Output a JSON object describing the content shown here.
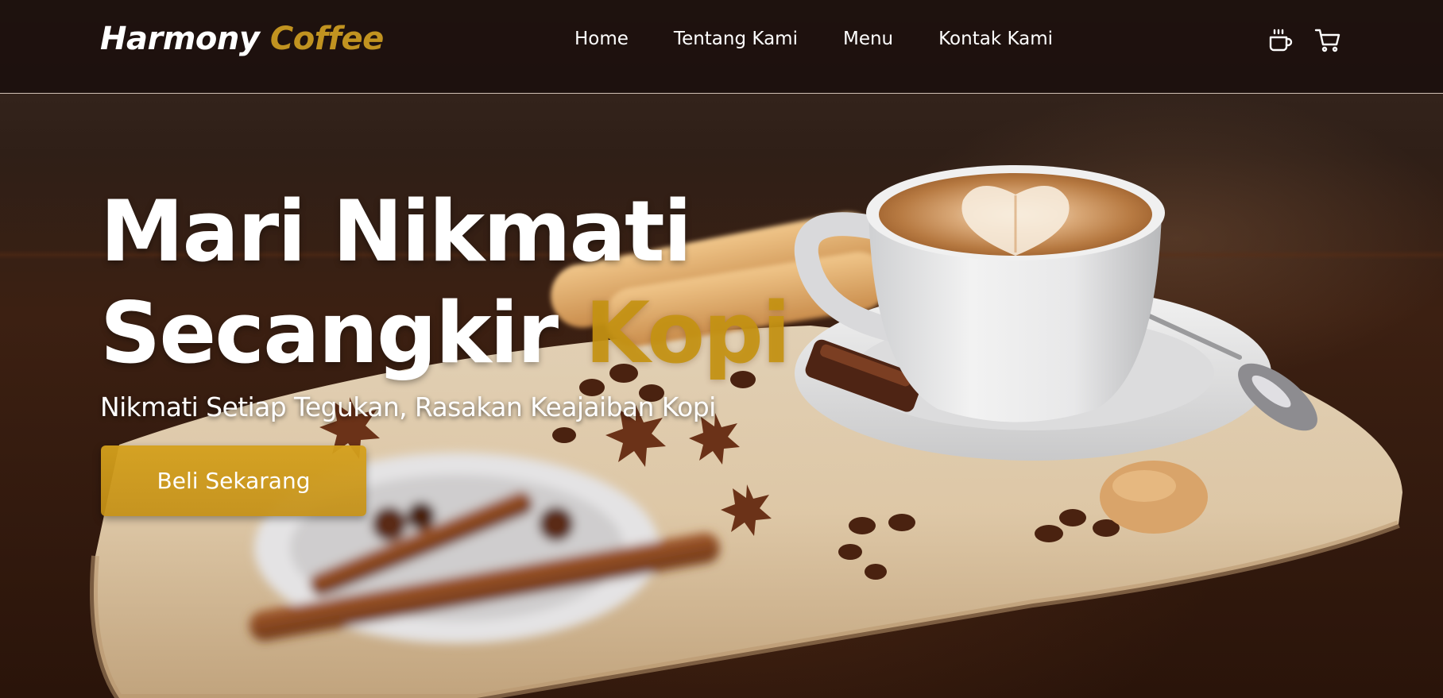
{
  "brand": {
    "name_primary": "Harmony",
    "name_accent": "Coffee"
  },
  "nav": {
    "links": [
      "Home",
      "Tentang Kami",
      "Menu",
      "Kontak Kami"
    ],
    "icons": [
      "coffee-cup-icon",
      "shopping-cart-icon"
    ]
  },
  "hero": {
    "title_line1": "Mari Nikmati",
    "title_line2_main": "Secangkir",
    "title_line2_accent": "Kopi",
    "subtitle": "Nikmati Setiap Tegukan, Rasakan Keajaiban Kopi",
    "cta_label": "Beli Sekarang"
  },
  "colors": {
    "accent": "#c19320",
    "navbar_bg": "#1c100d",
    "text": "#ffffff",
    "button": "#d4a01c"
  }
}
